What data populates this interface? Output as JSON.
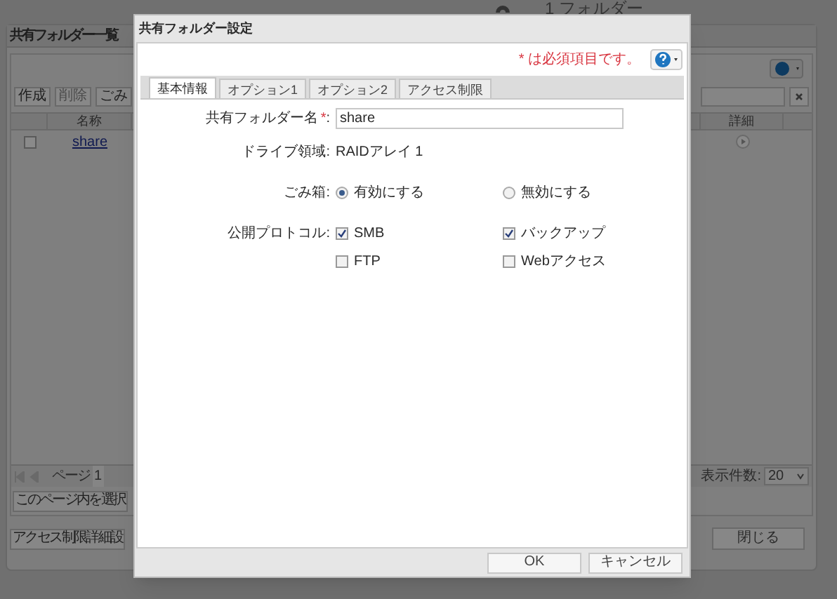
{
  "header": {
    "folder_count": "1 フォルダー"
  },
  "list_panel": {
    "title": "共有フォルダー一覧",
    "toolbar": [
      {
        "label": "作成",
        "disabled": false
      },
      {
        "label": "削除",
        "disabled": true
      },
      {
        "label": "ごみ",
        "disabled": false
      }
    ],
    "columns": [
      "名称",
      "詳細"
    ],
    "rows": [
      {
        "checked": false,
        "name": "share"
      }
    ],
    "pager": {
      "page_label": "ページ",
      "page": "1",
      "page_size_label": "表示件数:",
      "page_size": "20"
    },
    "select_page_button": "このページ内を選択",
    "access_button": "アクセス制限詳細設",
    "close_button": "閉じる"
  },
  "dialog": {
    "title": "共有フォルダー設定",
    "required_note": "* は必須項目です。",
    "tabs": [
      {
        "label": "基本情報",
        "selected": true
      },
      {
        "label": "オプション1",
        "selected": false
      },
      {
        "label": "オプション2",
        "selected": false
      },
      {
        "label": "アクセス制限",
        "selected": false
      }
    ],
    "rows": [
      {
        "kind": "text_input",
        "label": "共有フォルダー名",
        "required_mark": "*",
        "colon": ":",
        "value": "share"
      },
      {
        "kind": "static",
        "label": "ドライブ領域:",
        "value": "RAIDアレイ 1"
      },
      {
        "kind": "radio",
        "label": "ごみ箱:",
        "options": [
          {
            "label": "有効にする",
            "selected": true
          },
          {
            "label": "無効にする",
            "selected": false
          }
        ]
      },
      {
        "kind": "checkbox",
        "label": "公開プロトコル:",
        "options": [
          {
            "label": "SMB",
            "checked": true
          },
          {
            "label": "バックアップ",
            "checked": true
          },
          {
            "label": "FTP",
            "checked": false
          },
          {
            "label": "Webアクセス",
            "checked": false
          }
        ]
      }
    ],
    "buttons": [
      "OK",
      "キャンセル"
    ]
  }
}
